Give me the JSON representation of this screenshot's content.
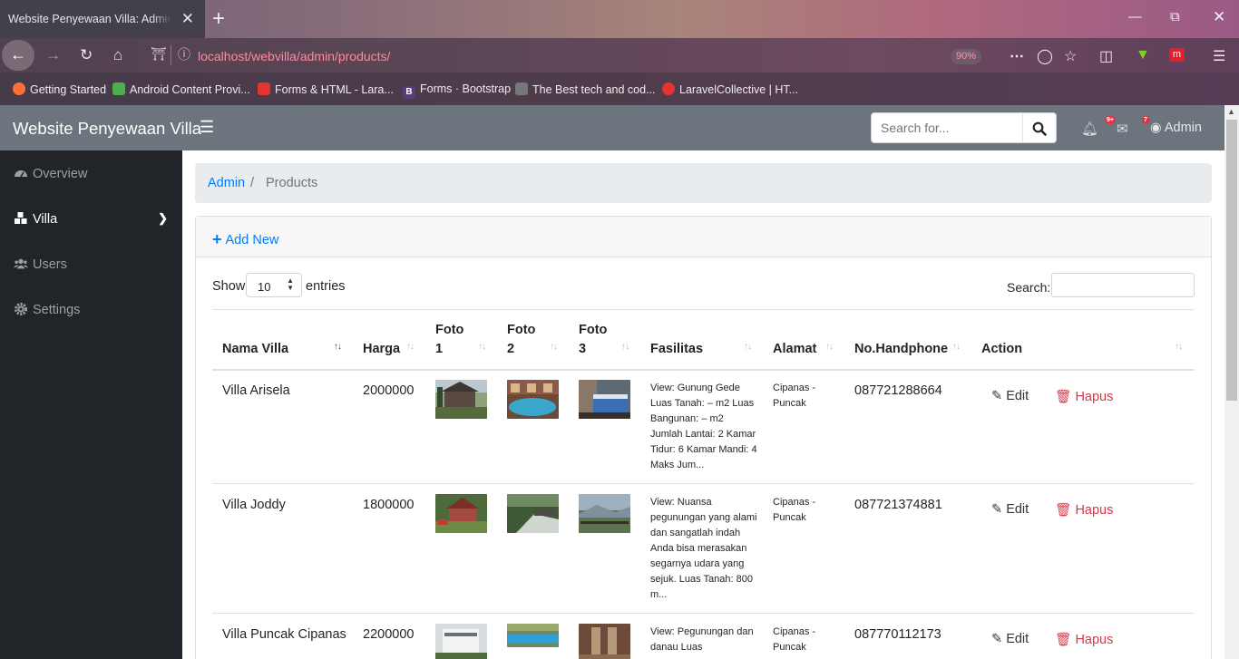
{
  "browser": {
    "tab_title": "Website Penyewaan Villa: Admin - Products",
    "tab_close": "✕",
    "new_tab": "+",
    "url": "localhost/webvilla/admin/products/",
    "zoom": "90%",
    "bookmarks": [
      {
        "label": "Getting Started",
        "color": "#ff7139"
      },
      {
        "label": "Android Content Provi...",
        "color": "#4caf50"
      },
      {
        "label": "Forms & HTML - Lara...",
        "color": "#e3342f"
      },
      {
        "label": "Forms · Bootstrap",
        "color": "#563d7c"
      },
      {
        "label": "The Best tech and cod...",
        "color": "#777777"
      },
      {
        "label": "LaravelCollective | HT...",
        "color": "#e3342f"
      }
    ]
  },
  "app": {
    "brand": "Website Penyewaan Villa",
    "search_placeholder": "Search for...",
    "bell_badge": "9+",
    "mail_badge": "7",
    "user": "Admin",
    "sidebar": [
      {
        "label": "Overview",
        "icon": "tachometer-icon"
      },
      {
        "label": "Villa",
        "icon": "cubes-icon",
        "active": true
      },
      {
        "label": "Users",
        "icon": "users-icon"
      },
      {
        "label": "Settings",
        "icon": "gear-icon"
      }
    ],
    "breadcrumb": {
      "root": "Admin",
      "sep": "/",
      "current": "Products"
    },
    "add_new": "Add New",
    "show_label": "Show",
    "show_value": "10",
    "entries_label": "entries",
    "search_label": "Search:",
    "columns": [
      "Nama Villa",
      "Harga",
      "Foto 1",
      "Foto 2",
      "Foto 3",
      "Fasilitas",
      "Alamat",
      "No.Handphone",
      "Action"
    ],
    "column_lines": {
      "foto1": [
        "Foto",
        "1"
      ],
      "foto2": [
        "Foto",
        "2"
      ],
      "foto3": [
        "Foto",
        "3"
      ]
    },
    "rows": [
      {
        "nama": "Villa Arisela",
        "harga": "2000000",
        "fasilitas": "View: Gunung Gede Luas Tanah: – m2 Luas Bangunan: – m2 Jumlah Lantai: 2 Kamar Tidur: 6 Kamar Mandi: 4 Maks Jum...",
        "alamat": "Cipanas - Puncak",
        "hp": "087721288664"
      },
      {
        "nama": "Villa Joddy",
        "harga": "1800000",
        "fasilitas": "View: Nuansa pegunungan yang alami dan sangatlah indah Anda bisa merasakan segarnya udara yang sejuk. Luas Tanah: 800 m...",
        "alamat": "Cipanas - Puncak",
        "hp": "087721374881"
      },
      {
        "nama": "Villa Puncak Cipanas",
        "harga": "2200000",
        "fasilitas": "View: Pegunungan dan danau Luas",
        "alamat": "Cipanas - Puncak",
        "hp": "087770112173"
      }
    ],
    "edit_label": "Edit",
    "delete_label": "Hapus"
  },
  "colors": {
    "link": "#007bff",
    "danger": "#dc3545",
    "sidebar_bg": "#212529",
    "topbar_bg": "#6c757d"
  }
}
